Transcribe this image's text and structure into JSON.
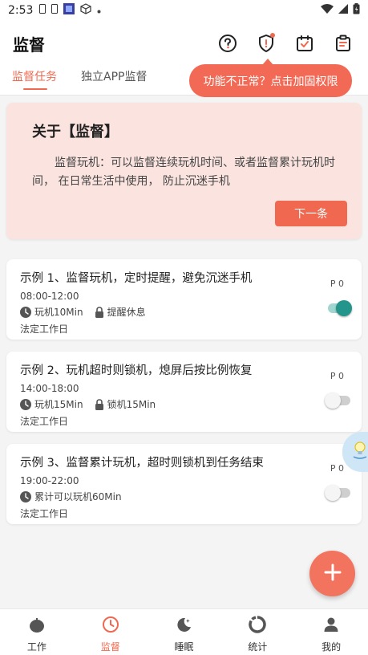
{
  "status_bar": {
    "time": "2:53"
  },
  "header": {
    "title": "监督",
    "icons": [
      "help-icon",
      "shield-alert-icon",
      "calendar-check-icon",
      "clipboard-icon"
    ]
  },
  "tabs": [
    {
      "label": "监督任务",
      "active": true
    },
    {
      "label": "独立APP监督",
      "active": false
    }
  ],
  "tooltip": {
    "text": "功能不正常？点击加固权限"
  },
  "about": {
    "title": "关于【监督】",
    "body": "监督玩机：可以监督连续玩机时间、或者监督累计玩机时间， 在日常生活中使用， 防止沉迷手机",
    "next_label": "下一条"
  },
  "tasks": [
    {
      "title": "示例 1、监督玩机，定时提醒，避免沉迷手机",
      "time": "08:00-12:00",
      "meta1": "玩机10Min",
      "meta2": "提醒休息",
      "day": "法定工作日",
      "p_label": "P 0",
      "enabled": true
    },
    {
      "title": "示例 2、玩机超时则锁机，熄屏后按比例恢复",
      "time": "14:00-18:00",
      "meta1": "玩机15Min",
      "meta2": "锁机15Min",
      "day": "法定工作日",
      "p_label": "P 0",
      "enabled": false
    },
    {
      "title": "示例 3、监督累计玩机，超时则锁机到任务结束",
      "time": "19:00-22:00",
      "meta1": "累计可以玩机60Min",
      "meta2": "",
      "day": "法定工作日",
      "p_label": "P 0",
      "enabled": false
    }
  ],
  "bottom_nav": [
    {
      "label": "工作",
      "icon": "tomato-icon",
      "active": false
    },
    {
      "label": "监督",
      "icon": "clock-icon",
      "active": true
    },
    {
      "label": "睡眠",
      "icon": "moon-icon",
      "active": false
    },
    {
      "label": "统计",
      "icon": "chart-ring-icon",
      "active": false
    },
    {
      "label": "我的",
      "icon": "person-icon",
      "active": false
    }
  ],
  "colors": {
    "accent": "#f0684f",
    "switch_on": "#23958a",
    "about_bg": "#fbe3df"
  }
}
